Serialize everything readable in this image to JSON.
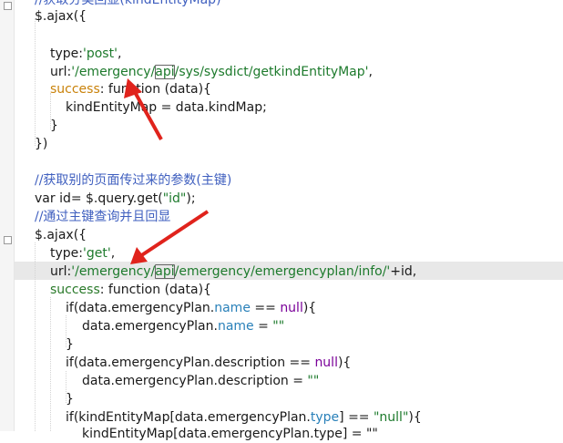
{
  "editor": {
    "lines": [
      {
        "id": "comment-top",
        "segments": [
          {
            "c": "comment",
            "t": "//获取分类回显(kindEntityMap)"
          }
        ]
      },
      {
        "id": "ajax-1",
        "segments": [
          {
            "c": "plain",
            "t": "$.ajax({"
          }
        ]
      },
      {
        "id": "blank-1",
        "segments": []
      },
      {
        "id": "type-post",
        "segments": [
          {
            "c": "plain",
            "t": "type:"
          },
          {
            "c": "string",
            "t": "'post'"
          },
          {
            "c": "plain",
            "t": ","
          }
        ]
      },
      {
        "id": "url-1",
        "segments": [
          {
            "c": "plain",
            "t": "url:"
          },
          {
            "c": "string",
            "t": "'/emergency/"
          },
          {
            "c": "stringbox",
            "t": "api"
          },
          {
            "c": "string",
            "t": "/sys/sysdict/getkindEntityMap'"
          },
          {
            "c": "plain",
            "t": ","
          }
        ]
      },
      {
        "id": "success-1",
        "segments": [
          {
            "c": "orange",
            "t": "success"
          },
          {
            "c": "plain",
            "t": ": function (data){"
          }
        ]
      },
      {
        "id": "kindmap-assign",
        "segments": [
          {
            "c": "plain",
            "t": "kindEntityMap = data.kindMap;"
          }
        ]
      },
      {
        "id": "close-fn-1",
        "segments": [
          {
            "c": "plain",
            "t": "}"
          }
        ]
      },
      {
        "id": "close-ajax-1",
        "segments": [
          {
            "c": "plain",
            "t": "})"
          }
        ]
      },
      {
        "id": "blank-2",
        "segments": []
      },
      {
        "id": "comment-params",
        "segments": [
          {
            "c": "comment",
            "t": "//获取别的页面传过来的参数(主键)"
          }
        ]
      },
      {
        "id": "var-id",
        "segments": [
          {
            "c": "plain",
            "t": "var id= $.query.get("
          },
          {
            "c": "string",
            "t": "\"id\""
          },
          {
            "c": "plain",
            "t": ");"
          }
        ]
      },
      {
        "id": "comment-query",
        "segments": [
          {
            "c": "comment",
            "t": "//通过主键查询并且回显"
          }
        ]
      },
      {
        "id": "ajax-2",
        "segments": [
          {
            "c": "plain",
            "t": "$.ajax({"
          }
        ]
      },
      {
        "id": "type-get",
        "segments": [
          {
            "c": "plain",
            "t": "type:"
          },
          {
            "c": "string",
            "t": "'get'"
          },
          {
            "c": "plain",
            "t": ","
          }
        ]
      },
      {
        "id": "url-2",
        "segments": [
          {
            "c": "plain",
            "t": "url:"
          },
          {
            "c": "string",
            "t": "'/emergency/"
          },
          {
            "c": "stringbox",
            "t": "api"
          },
          {
            "c": "string",
            "t": "/emergency/emergencyplan/info/'"
          },
          {
            "c": "plain",
            "t": "+id,"
          }
        ]
      },
      {
        "id": "success-2",
        "segments": [
          {
            "c": "key",
            "t": "success"
          },
          {
            "c": "plain",
            "t": ": function (data){"
          }
        ]
      },
      {
        "id": "if-name",
        "segments": [
          {
            "c": "plain",
            "t": "if(data.emergencyPlan."
          },
          {
            "c": "prop",
            "t": "name"
          },
          {
            "c": "plain",
            "t": " == "
          },
          {
            "c": "null",
            "t": "null"
          },
          {
            "c": "plain",
            "t": "){"
          }
        ]
      },
      {
        "id": "assign-name",
        "segments": [
          {
            "c": "plain",
            "t": "data.emergencyPlan."
          },
          {
            "c": "prop",
            "t": "name"
          },
          {
            "c": "plain",
            "t": " = "
          },
          {
            "c": "string",
            "t": "\"\""
          }
        ]
      },
      {
        "id": "close-if-name",
        "segments": [
          {
            "c": "plain",
            "t": "}"
          }
        ]
      },
      {
        "id": "if-desc",
        "segments": [
          {
            "c": "plain",
            "t": "if(data.emergencyPlan.description == "
          },
          {
            "c": "null",
            "t": "null"
          },
          {
            "c": "plain",
            "t": "){"
          }
        ]
      },
      {
        "id": "assign-desc",
        "segments": [
          {
            "c": "plain",
            "t": "data.emergencyPlan.description = "
          },
          {
            "c": "string",
            "t": "\"\""
          }
        ]
      },
      {
        "id": "close-if-desc",
        "segments": [
          {
            "c": "plain",
            "t": "}"
          }
        ]
      },
      {
        "id": "if-kind",
        "segments": [
          {
            "c": "plain",
            "t": "if(kindEntityMap[data.emergencyPlan."
          },
          {
            "c": "prop",
            "t": "type"
          },
          {
            "c": "plain",
            "t": "] == "
          },
          {
            "c": "string",
            "t": "\"null\""
          },
          {
            "c": "plain",
            "t": "){"
          }
        ]
      },
      {
        "id": "kind-partial",
        "segments": [
          {
            "c": "plain",
            "t": "kindEntityMap[data.emergencyPlan.type] = \"\""
          }
        ]
      }
    ]
  },
  "colors": {
    "comment": "#3f5fbf",
    "string": "#1d7a2c",
    "arrow": "#e0231c",
    "highlight_line": "#e8e8e8"
  },
  "annotations": [
    {
      "name": "red-arrow-1",
      "icon": "arrow-icon"
    },
    {
      "name": "red-arrow-2",
      "icon": "arrow-icon"
    }
  ]
}
